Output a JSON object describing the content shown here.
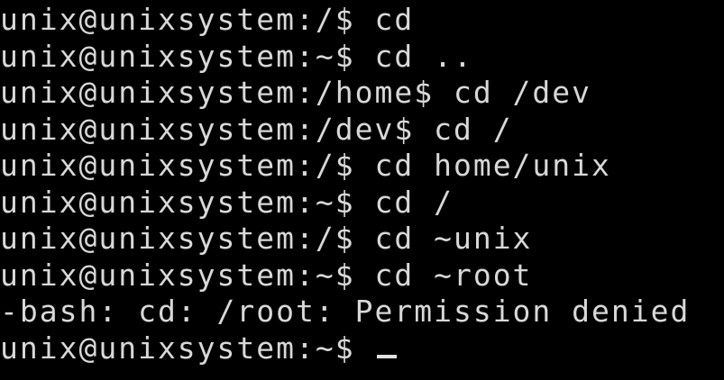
{
  "terminal": {
    "lines": [
      "unix@unixsystem:/$ cd",
      "unix@unixsystem:~$ cd ..",
      "unix@unixsystem:/home$ cd /dev",
      "unix@unixsystem:/dev$ cd /",
      "unix@unixsystem:/$ cd home/unix",
      "unix@unixsystem:~$ cd /",
      "unix@unixsystem:/$ cd ~unix",
      "unix@unixsystem:~$ cd ~root",
      "-bash: cd: /root: Permission denied"
    ],
    "prompt": "unix@unixsystem:~$ ",
    "colors": {
      "background": "#000000",
      "text": "#d8d8d8",
      "cursor": "#e0e0e0"
    }
  }
}
